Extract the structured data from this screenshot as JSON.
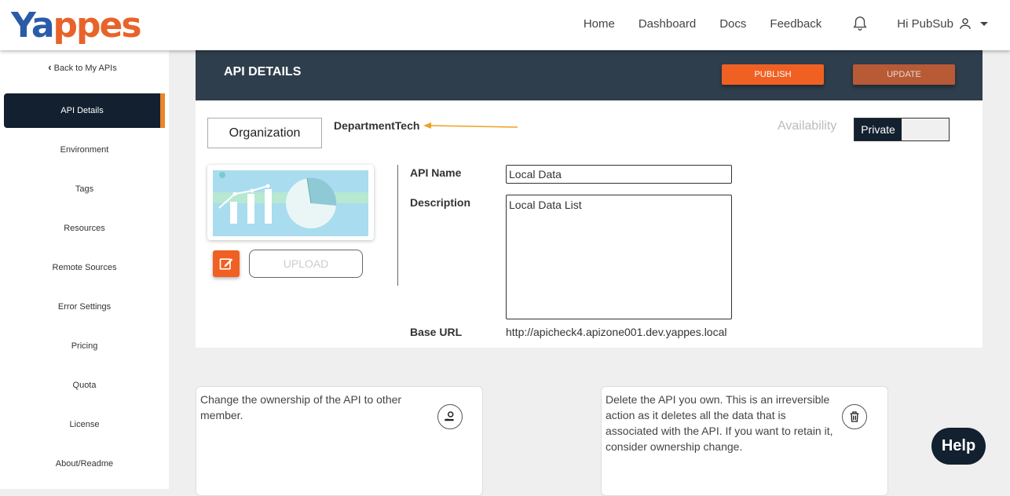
{
  "brand": {
    "logo_text_a": "Ya",
    "logo_text_b": "ppes"
  },
  "nav": {
    "home": "Home",
    "dashboard": "Docs",
    "docs": "Docs",
    "feedback": "Feedback",
    "links": [
      "Home",
      "Dashboard",
      "Docs",
      "Feedback"
    ],
    "user_greeting": "Hi PubSub"
  },
  "sidebar": {
    "back_label": "Back to My APIs",
    "items": [
      {
        "label": "API Details",
        "active": true
      },
      {
        "label": "Environment"
      },
      {
        "label": "Tags"
      },
      {
        "label": "Resources"
      },
      {
        "label": "Remote Sources"
      },
      {
        "label": "Error Settings"
      },
      {
        "label": "Pricing"
      },
      {
        "label": "Quota"
      },
      {
        "label": "License"
      },
      {
        "label": "About/Readme"
      }
    ]
  },
  "header": {
    "title": "API DETAILS",
    "publish_label": "PUBLISH",
    "update_label": "UPDATE"
  },
  "details": {
    "organization_label": "Organization",
    "organization_value": "DepartmentTech",
    "availability_label": "Availability",
    "availability_value": "Private",
    "upload_label": "UPLOAD",
    "api_name_label": "API Name",
    "api_name_value": "Local Data",
    "description_label": "Description",
    "description_value": "Local Data List",
    "base_url_label": "Base URL",
    "base_url_value": "http://apicheck4.apizone001.dev.yappes.local"
  },
  "cards": {
    "ownership_text": "Change the ownership of the API to other member.",
    "delete_text": "Delete the API you own. This is an irreversible action as it deletes all the data that is associated with the API. If you want to retain it, consider ownership change."
  },
  "help_label": "Help",
  "colors": {
    "accent": "#f06022",
    "dark": "#12202f",
    "header": "#2e3e4c",
    "sidebar_marker": "#e8862a"
  }
}
